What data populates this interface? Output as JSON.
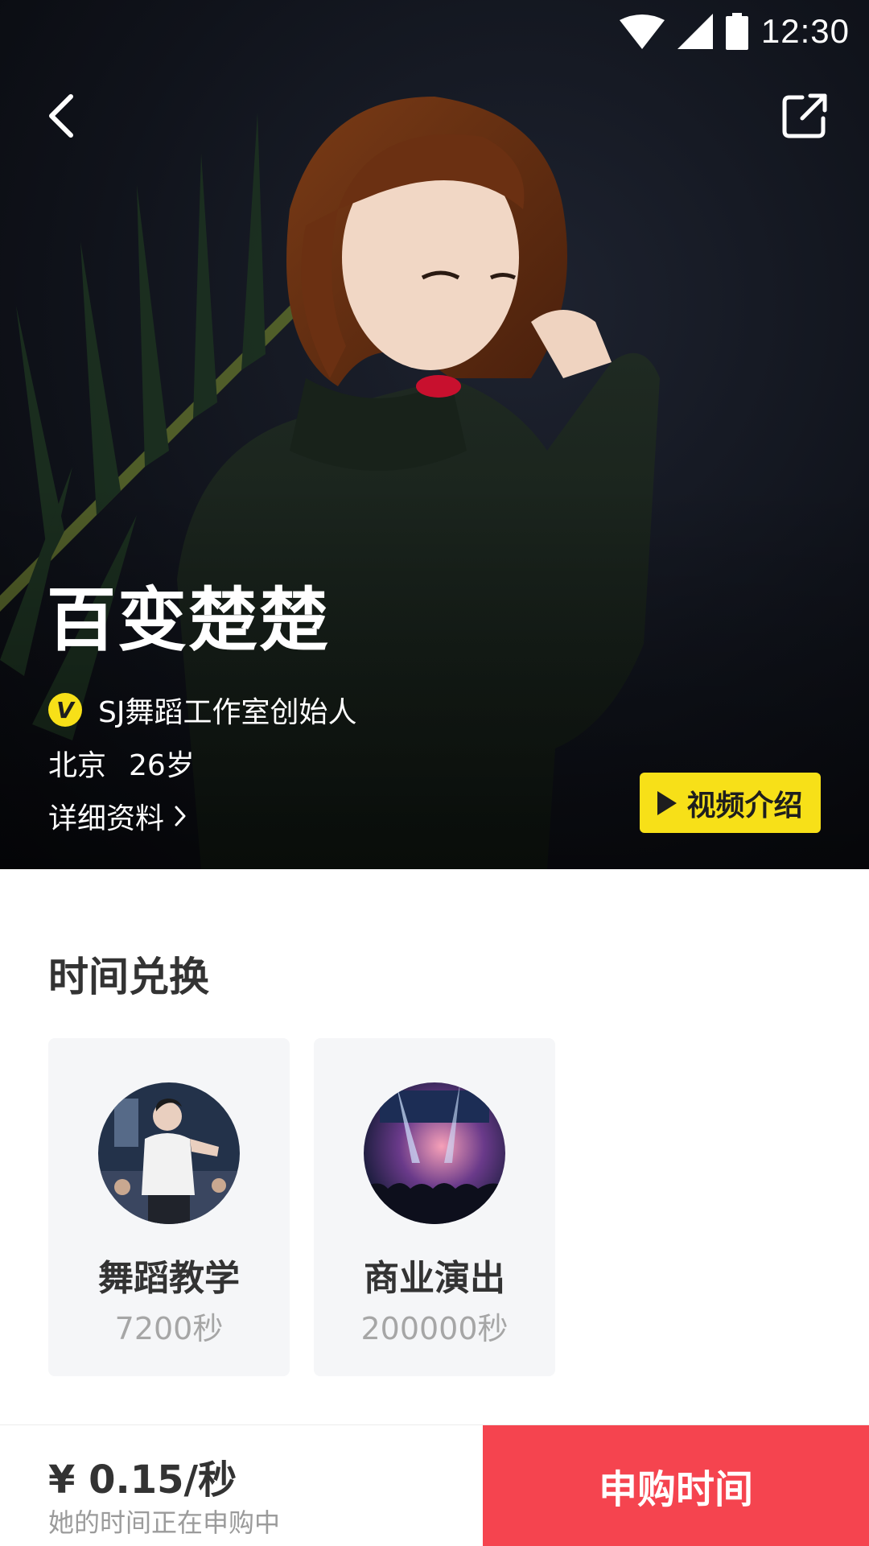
{
  "status_bar": {
    "time": "12:30",
    "icons": [
      "wifi-icon",
      "signal-icon",
      "battery-icon"
    ]
  },
  "header": {
    "back_icon": "chevron-left-icon",
    "share_icon": "share-external-icon"
  },
  "profile": {
    "name": "百变楚楚",
    "verified_badge": "V",
    "title": "SJ舞蹈工作室创始人",
    "city": "北京",
    "age": "26岁",
    "detail_link": "详细资料",
    "video_button": "视频介绍"
  },
  "exchange": {
    "section_title": "时间兑换",
    "items": [
      {
        "title": "舞蹈教学",
        "duration": "7200秒"
      },
      {
        "title": "商业演出",
        "duration": "200000秒"
      }
    ]
  },
  "purchase": {
    "price": "¥ 0.15/秒",
    "status": "她的时间正在申购中",
    "button": "申购时间"
  },
  "colors": {
    "accent_yellow": "#f7e018",
    "buy_red": "#f5444f",
    "title_text": "#333333",
    "secondary_text": "#a6a6a6"
  }
}
